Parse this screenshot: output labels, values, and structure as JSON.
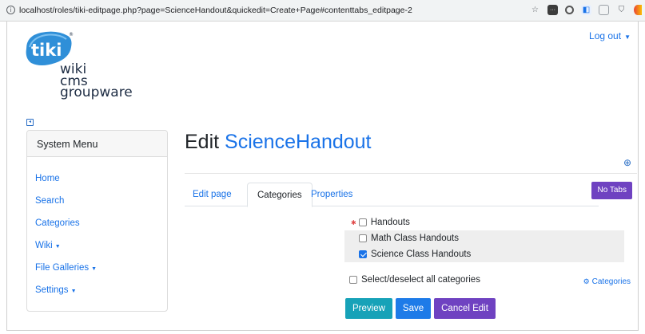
{
  "browser": {
    "url": "localhost/roles/tiki-editpage.php?page=ScienceHandout&quickedit=Create+Page#contenttabs_editpage-2",
    "info_glyph": "i",
    "icons": [
      "star-icon",
      "extension-dark-icon",
      "extension-circle-icon",
      "extension-blue-icon",
      "extension-grey-icon",
      "shield-icon",
      "extension-multicolor-icon"
    ]
  },
  "header": {
    "logout_label": "Log out",
    "logo": {
      "badge_text": "tiki",
      "line1": "wiki",
      "line2": "cms",
      "line3": "groupware"
    }
  },
  "sidebar": {
    "title": "System Menu",
    "items": [
      {
        "label": "Home",
        "has_caret": false
      },
      {
        "label": "Search",
        "has_caret": false
      },
      {
        "label": "Categories",
        "has_caret": false
      },
      {
        "label": "Wiki",
        "has_caret": true
      },
      {
        "label": "File Galleries",
        "has_caret": true
      },
      {
        "label": "Settings",
        "has_caret": true
      }
    ]
  },
  "main": {
    "title_prefix": "Edit",
    "page_name": "ScienceHandout",
    "no_tabs_label": "No Tabs",
    "tabs": [
      {
        "label": "Edit page",
        "active": false
      },
      {
        "label": "Categories",
        "active": true
      },
      {
        "label": "Properties",
        "active": false
      }
    ],
    "categories": [
      {
        "label": "Handouts",
        "checked": false,
        "level": 0,
        "required": true
      },
      {
        "label": "Math Class Handouts",
        "checked": false,
        "level": 1
      },
      {
        "label": "Science Class Handouts",
        "checked": true,
        "level": 1
      }
    ],
    "select_all_label": "Select/deselect all categories",
    "categories_link_label": "Categories",
    "buttons": {
      "preview": "Preview",
      "save": "Save",
      "cancel": "Cancel Edit"
    }
  },
  "colors": {
    "link": "#1a73e8",
    "preview": "#17a2b8",
    "save": "#1e7be8",
    "purple": "#6f42c1",
    "logo_blue": "#2f8fd8",
    "logo_text": "#1e2d44"
  }
}
